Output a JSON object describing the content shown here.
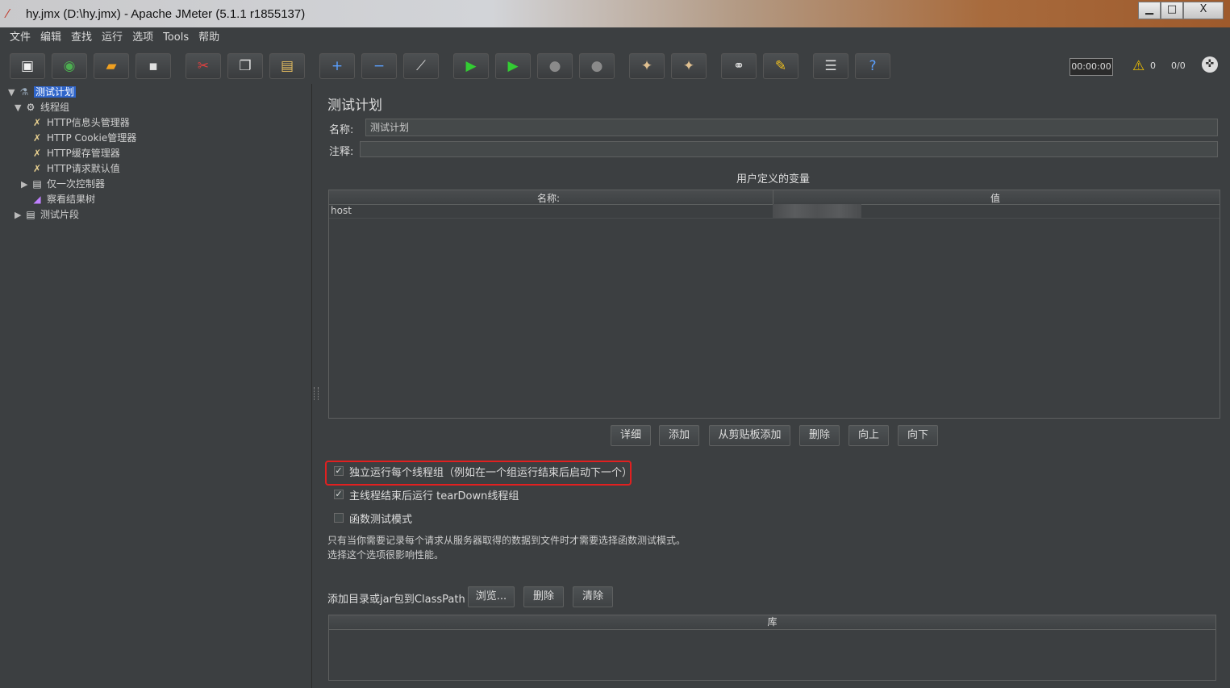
{
  "window": {
    "title": "hy.jmx (D:\\hy.jmx) - Apache JMeter (5.1.1 r1855137)",
    "minimize": "▁",
    "maximize": "□",
    "close": "X"
  },
  "menu": [
    "文件",
    "编辑",
    "查找",
    "运行",
    "选项",
    "Tools",
    "帮助"
  ],
  "toolbar": {
    "buttons": [
      {
        "name": "new-icon",
        "glyph": "▣",
        "color": "#f2f2f2"
      },
      {
        "name": "templates-icon",
        "glyph": "◉",
        "color": "#4caf50"
      },
      {
        "name": "open-icon",
        "glyph": "▰",
        "color": "#f0a020"
      },
      {
        "name": "save-icon",
        "glyph": "▪",
        "color": "#e0e0e0"
      },
      {
        "name": "cut-icon",
        "glyph": "✂",
        "color": "#e04040"
      },
      {
        "name": "copy-icon",
        "glyph": "❐",
        "color": "#e0e0e0"
      },
      {
        "name": "paste-icon",
        "glyph": "▤",
        "color": "#e8c060"
      },
      {
        "name": "expand-icon",
        "glyph": "+",
        "color": "#5aa0ff"
      },
      {
        "name": "collapse-icon",
        "glyph": "−",
        "color": "#5aa0ff"
      },
      {
        "name": "toggle-icon",
        "glyph": "⟋",
        "color": "#dddddd"
      },
      {
        "name": "start-icon",
        "glyph": "▶",
        "color": "#33cc33"
      },
      {
        "name": "start-no-pause-icon",
        "glyph": "▶",
        "color": "#33cc33"
      },
      {
        "name": "stop-icon",
        "glyph": "●",
        "color": "#8a8a8a"
      },
      {
        "name": "shutdown-icon",
        "glyph": "●",
        "color": "#8a8a8a"
      },
      {
        "name": "clear-icon",
        "glyph": "✦",
        "color": "#e0c090"
      },
      {
        "name": "clear-all-icon",
        "glyph": "✦",
        "color": "#e0c090"
      },
      {
        "name": "search-icon",
        "glyph": "⚭",
        "color": "#dddddd"
      },
      {
        "name": "reset-search-icon",
        "glyph": "✎",
        "color": "#f0c020"
      },
      {
        "name": "function-helper-icon",
        "glyph": "☰",
        "color": "#dddddd"
      },
      {
        "name": "help-icon",
        "glyph": "?",
        "color": "#5aa0ff"
      }
    ],
    "timer": "00:00:00",
    "warning_count": "0",
    "thread_ratio": "0/0"
  },
  "tree": {
    "items": [
      {
        "label": "测试计划",
        "icon": "🧪",
        "arrow": "▼",
        "selected": true
      },
      {
        "label": "线程组",
        "icon": "⚙",
        "arrow": "▼"
      },
      {
        "label": "HTTP信息头管理器",
        "icon": "✗",
        "arrow": ""
      },
      {
        "label": "HTTP Cookie管理器",
        "icon": "✗",
        "arrow": ""
      },
      {
        "label": "HTTP缓存管理器",
        "icon": "✗",
        "arrow": ""
      },
      {
        "label": "HTTP请求默认值",
        "icon": "✗",
        "arrow": ""
      },
      {
        "label": "仅一次控制器",
        "icon": "▤",
        "arrow": "▶"
      },
      {
        "label": "察看结果树",
        "icon": "◢",
        "arrow": ""
      },
      {
        "label": "测试片段",
        "icon": "▤",
        "arrow": "▶"
      }
    ]
  },
  "panel": {
    "title": "测试计划",
    "name_label": "名称:",
    "name_value": "测试计划",
    "comment_label": "注释:",
    "comment_value": "",
    "variables_title": "用户定义的变量",
    "var_columns": [
      "名称:",
      "值"
    ],
    "var_rows": [
      {
        "name": "host",
        "value": ""
      }
    ],
    "var_buttons": [
      "详细",
      "添加",
      "从剪贴板添加",
      "删除",
      "向上",
      "向下"
    ],
    "checkboxes": [
      {
        "label": "独立运行每个线程组（例如在一个组运行结束后启动下一个）",
        "checked": true
      },
      {
        "label": "主线程结束后运行 tearDown线程组",
        "checked": true
      },
      {
        "label": "函数测试模式",
        "checked": false
      }
    ],
    "description_line1": "只有当你需要记录每个请求从服务器取得的数据到文件时才需要选择函数测试模式。",
    "description_line2": "选择这个选项很影响性能。",
    "classpath_label": "添加目录或jar包到ClassPath",
    "classpath_buttons": [
      "浏览...",
      "删除",
      "清除"
    ],
    "library_column": "库",
    "highlight_color": "#e12020"
  }
}
